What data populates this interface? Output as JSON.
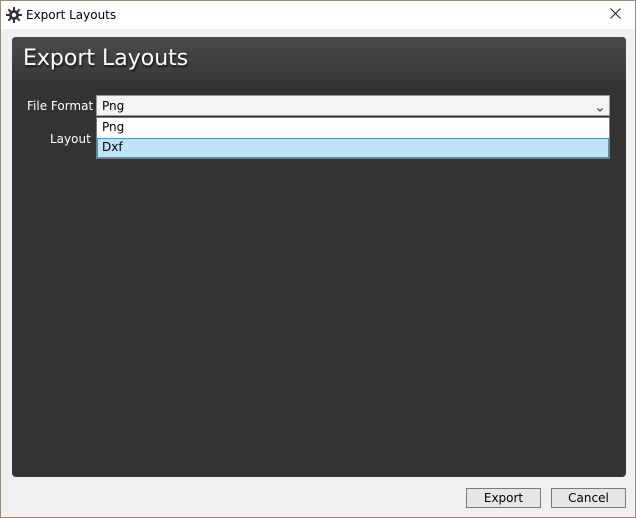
{
  "window": {
    "title": "Export Layouts",
    "icon": "gear-icon",
    "close_icon": "close-icon"
  },
  "dialog": {
    "heading": "Export Layouts",
    "file_format_label": "File Format",
    "layout_label": "Layout",
    "file_format": {
      "selected": "Png",
      "options": [
        "Png",
        "Dxf"
      ],
      "highlighted_option": "Dxf",
      "expanded": true
    }
  },
  "buttons": {
    "export_label": "Export",
    "cancel_label": "Cancel"
  },
  "colors": {
    "panel_bg": "#333333",
    "highlight_bg": "#bde3f5",
    "highlight_border": "#3a9ad0"
  }
}
